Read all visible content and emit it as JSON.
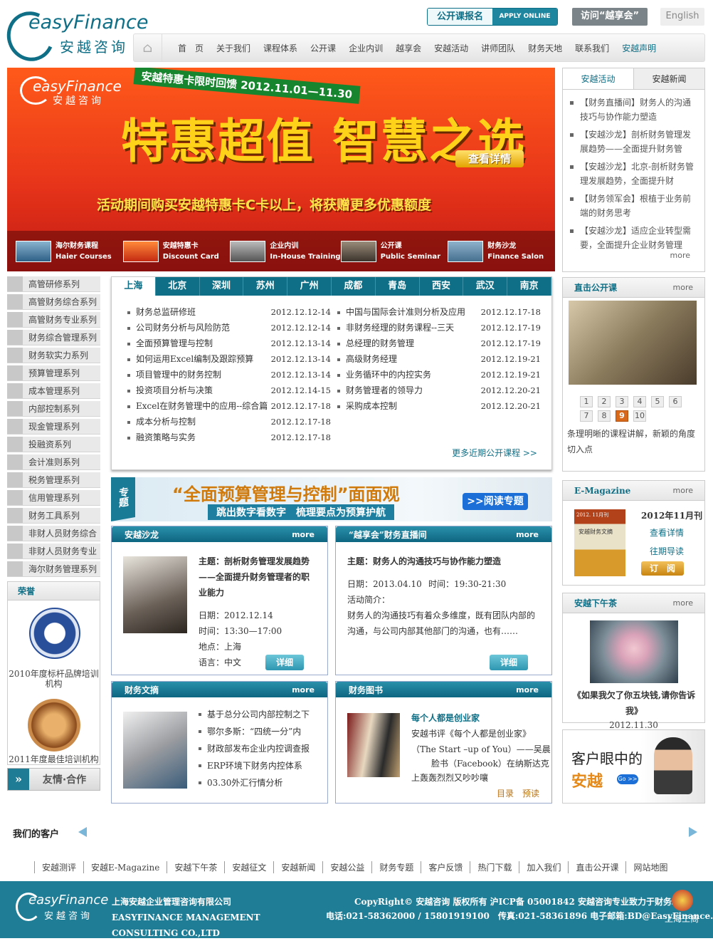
{
  "header": {
    "logo_en": "easyFinance",
    "logo_zh": "安越咨询",
    "open_course_label": "公开课报名",
    "apply_label": "APPLY ONLINE",
    "visit_label": "访问“越享会”",
    "english_label": "English"
  },
  "nav": {
    "items": [
      "首　页",
      "关于我们",
      "课程体系",
      "公开课",
      "企业内训",
      "越享会",
      "安越活动",
      "讲师团队",
      "财务天地",
      "联系我们",
      "安越声明"
    ]
  },
  "banner": {
    "logo_en": "easyFinance",
    "logo_zh": "安越咨询",
    "tag": "安越特惠卡限时回馈 2012.11.01—11.30",
    "headline": "特惠超值 智慧之选",
    "detail_button": "查看详情",
    "slogan": "活动期间购买安越特惠卡C卡以上，将获赠更多优惠额度",
    "thumbs": [
      {
        "zh": "海尔财务课程",
        "en": "Haier Courses"
      },
      {
        "zh": "安越特惠卡",
        "en": "Discount Card"
      },
      {
        "zh": "企业内训",
        "en": "In-House Training"
      },
      {
        "zh": "公开课",
        "en": "Public Seminar"
      },
      {
        "zh": "财务沙龙",
        "en": "Finance Salon"
      }
    ]
  },
  "activity": {
    "tab_active": "安越活动",
    "tab_other": "安越新闻",
    "items": [
      "【财务直播间】财务人的沟通技巧与协作能力塑造",
      "【安越沙龙】剖析财务管理发展趋势——全面提升财务管",
      "【安越沙龙】北京-剖析财务管理发展趋势，全面提升财",
      "【财务领军会】根植于业务前端的财务思考",
      "【安越沙龙】适应企业转型需要，全面提升企业财务管理"
    ],
    "more": "more"
  },
  "sidebar": {
    "items": [
      "高管研修系列",
      "高管财务综合系列",
      "高管财务专业系列",
      "财务综合管理系列",
      "财务软实力系列",
      "预算管理系列",
      "成本管理系列",
      "内部控制系列",
      "现金管理系列",
      "投融资系列",
      "会计准则系列",
      "税务管理系列",
      "信用管理系列",
      "财务工具系列",
      "非财人员财务综合",
      "非财人员财务专业",
      "海尔财务管理系列"
    ],
    "honor_title": "荣誉",
    "honor1": "2010年度标杆品牌培训机构",
    "honor2": "2011年度最佳培训机构",
    "partner": "友情·合作"
  },
  "courses": {
    "cities": [
      "上海",
      "北京",
      "深圳",
      "苏州",
      "广州",
      "成都",
      "青岛",
      "西安",
      "武汉",
      "南京"
    ],
    "left": [
      {
        "name": "财务总监研修班",
        "date": "2012.12.12-14"
      },
      {
        "name": "公司财务分析与风险防范",
        "date": "2012.12.12-14"
      },
      {
        "name": "全面预算管理与控制",
        "date": "2012.12.13-14"
      },
      {
        "name": "如何运用Excel编制及跟踪预算",
        "date": "2012.12.13-14"
      },
      {
        "name": "项目管理中的财务控制",
        "date": "2012.12.13-14"
      },
      {
        "name": "投资项目分析与决策",
        "date": "2012.12.14-15"
      },
      {
        "name": "Excel在财务管理中的应用--综合篇",
        "date": "2012.12.17-18"
      },
      {
        "name": "成本分析与控制",
        "date": "2012.12.17-18"
      },
      {
        "name": "融资策略与实务",
        "date": "2012.12.17-18"
      }
    ],
    "right": [
      {
        "name": "中国与国际会计准则分析及应用",
        "date": "2012.12.17-18"
      },
      {
        "name": "非财务经理的财务课程--三天",
        "date": "2012.12.17-19"
      },
      {
        "name": "总经理的财务管理",
        "date": "2012.12.17-19"
      },
      {
        "name": "高级财务经理",
        "date": "2012.12.19-21"
      },
      {
        "name": "业务循环中的内控实务",
        "date": "2012.12.19-21"
      },
      {
        "name": "财务管理者的领导力",
        "date": "2012.12.20-21"
      },
      {
        "name": "采购成本控制",
        "date": "2012.12.20-21"
      }
    ],
    "more": "更多近期公开课程 >>"
  },
  "live": {
    "title": "直击公开课",
    "more": "more",
    "pages_row1": [
      "1",
      "2",
      "3",
      "4",
      "5",
      "6"
    ],
    "pages_row2": [
      "7",
      "8",
      "9",
      "10"
    ],
    "active_page": "9",
    "caption": "条理明晰的课程讲解，新颖的角度切入点"
  },
  "topic": {
    "ribbon": "专题",
    "title": "“全面预算管理与控制”面面观",
    "subtitle": "跳出数字看数字　梳理要点为预算护航",
    "read": ">>阅读专题"
  },
  "salon": {
    "title": "安越沙龙",
    "more": "more",
    "topic": "主题：剖析财务管理发展趋势——全面提升财务管理者的职业能力",
    "date": "日期：2012.12.14",
    "time": "时间：13:30—17:00",
    "place": "地点：上海",
    "lang": "语言：中文",
    "btn": "详细"
  },
  "livestream": {
    "title": "“越享会”财务直播间",
    "more": "more",
    "topic": "主题：财务人的沟通技巧与协作能力塑造",
    "date": "日期：2013.04.10",
    "time": "时间：19:30-21:30",
    "intro_label": "活动简介：",
    "intro": "财务人的沟通技巧有着众多维度，既有团队内部的沟通，与公司内部其他部门的沟通，也有……",
    "btn": "详细"
  },
  "emag": {
    "title": "E-Magazine",
    "more": "more",
    "issue": "2012年11月刊",
    "view": "查看详情",
    "past": "往期导读",
    "subscribe": "订　阅",
    "cover_text": "2012. 11月刊",
    "cover_title": "安越财务文摘"
  },
  "tea": {
    "title": "安越下午茶",
    "more": "more",
    "caption": "《如果我欠了你五块钱,请你告诉我》",
    "date": "2012.11.30"
  },
  "ad": {
    "line1": "客户眼中的",
    "line2": "安越",
    "go": "Go >>"
  },
  "digest": {
    "title": "财务文摘",
    "more": "more",
    "items": [
      "基于总分公司内部控制之下",
      "鄂尔多斯：“四统一分”内",
      "财政部发布企业内控调查报",
      "ERP环境下财务内控体系",
      "03.30外汇行情分析"
    ]
  },
  "books": {
    "title": "财务图书",
    "more": "more",
    "book": "每个人都是创业家",
    "line1": "安越书评《每个人都是创业家》",
    "line2": "（The Start –up of You）——吴晨",
    "line3": "脸书（Facebook）在纳斯达克",
    "line4": "上轰轰烈烈又吵吵嚷",
    "toc": "目录",
    "preview": "预读"
  },
  "clients_title": "我们的客户",
  "links": [
    "安越测评",
    "安越E-Magazine",
    "安越下午茶",
    "安越征文",
    "安越新闻",
    "安越公益",
    "财务专题",
    "客户反馈",
    "热门下载",
    "加入我们",
    "直击公开课",
    "网站地图"
  ],
  "footer": {
    "logo_en": "easyFinance",
    "logo_zh": "安越咨询",
    "company_zh": "上海安越企业管理咨询有限公司",
    "company_en": "EASYFINANCE MANAGEMENT CONSULTING CO.,LTD",
    "copyright": "CopyRight© 安越咨询 版权所有 沪ICP备 05001842 安越咨询专业致力于财务培训",
    "contact": "电话:021-58362000 / 15801919100　传真:021-58361896 电子邮箱:BD@EasyFinance.com.cn",
    "emblem": "上海工商"
  },
  "colors": {
    "brand": "#0f6f86",
    "banner": "#e8361a",
    "accent": "#ffd21a"
  }
}
